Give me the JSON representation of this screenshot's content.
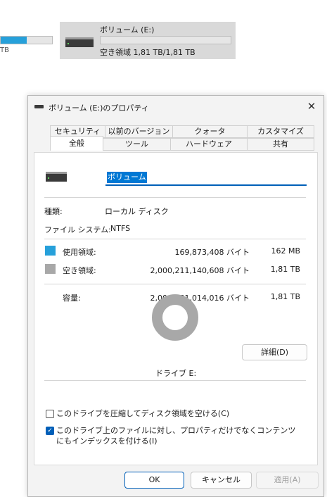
{
  "explorer": {
    "left_drive_size": "TB",
    "left_drive_usage_fraction": 0.5,
    "drive_tile": {
      "name": "ボリューム (E:)",
      "free_text": "空き領域 1,81 TB/1,81 TB",
      "usage_fraction": 0.0001
    }
  },
  "dialog": {
    "title": "ボリューム (E:)のプロパティ",
    "close_glyph": "✕",
    "tabs_upper": [
      "セキュリティ",
      "以前のバージョン",
      "クォータ",
      "カスタマイズ"
    ],
    "tabs_lower": [
      "全般",
      "ツール",
      "ハードウェア",
      "共有"
    ],
    "active_tab": "全般",
    "volume_name": "ボリューム",
    "type_label": "種類:",
    "type_value": "ローカル ディスク",
    "fs_label": "ファイル システム:",
    "fs_value": "NTFS",
    "used": {
      "label": "使用領域:",
      "bytes": "169,873,408 バイト",
      "size": "162 MB",
      "color": "#26a0da"
    },
    "free": {
      "label": "空き領域:",
      "bytes": "2,000,211,140,608 バイト",
      "size": "1,81 TB",
      "color": "#a8a8a8"
    },
    "capacity": {
      "label": "容量:",
      "bytes": "2,000,381,014,016 バイト",
      "size": "1,81 TB"
    },
    "drive_label": "ドライブ E:",
    "details_button": "詳細(D)",
    "compress_checkbox": {
      "label": "このドライブを圧縮してディスク領域を空ける(C)",
      "checked": false
    },
    "index_checkbox": {
      "label": "このドライブ上のファイルに対し、プロパティだけでなくコンテンツにもインデックスを付ける(I)",
      "checked": true
    },
    "ok_button": "OK",
    "cancel_button": "キャンセル",
    "apply_button": "適用(A)"
  }
}
